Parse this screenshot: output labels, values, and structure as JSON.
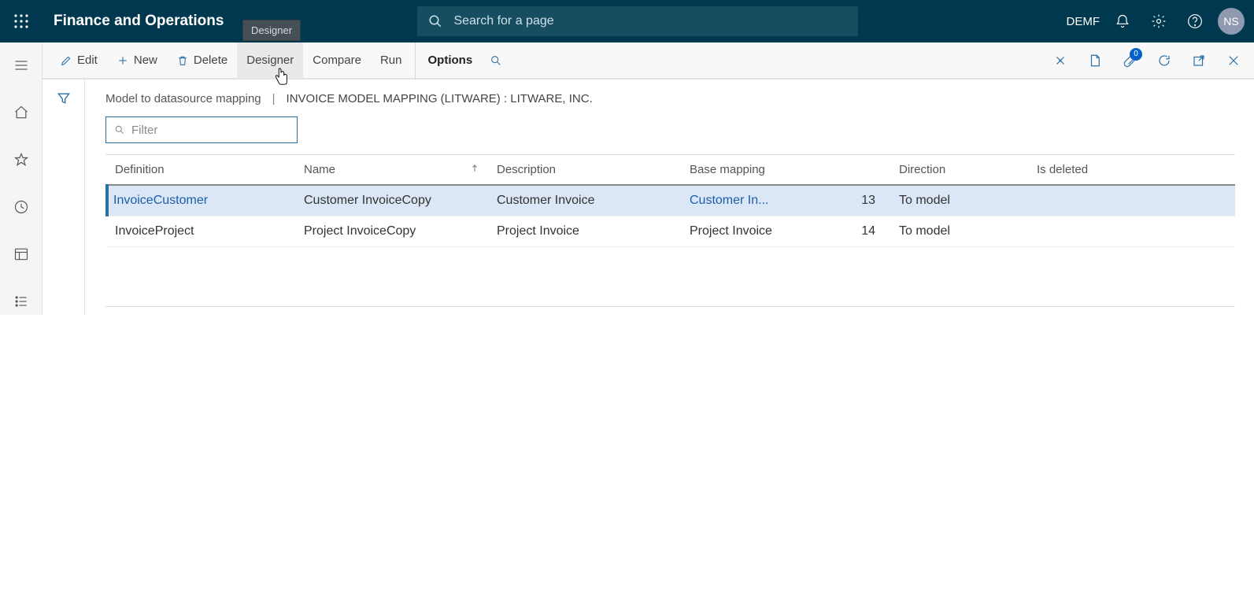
{
  "header": {
    "app_title": "Finance and Operations",
    "search_placeholder": "Search for a page",
    "company": "DEMF",
    "avatar_initials": "NS",
    "tooltip_designer": "Designer",
    "attachments_badge": "0"
  },
  "actions": {
    "edit": "Edit",
    "new": "New",
    "delete": "Delete",
    "designer": "Designer",
    "compare": "Compare",
    "run": "Run",
    "options": "Options"
  },
  "breadcrumb": {
    "page": "Model to datasource mapping",
    "title": "INVOICE MODEL MAPPING (LITWARE) : LITWARE, INC."
  },
  "filter": {
    "placeholder": "Filter"
  },
  "columns": {
    "definition": "Definition",
    "name": "Name",
    "description": "Description",
    "base_mapping": "Base mapping",
    "direction": "Direction",
    "is_deleted": "Is deleted"
  },
  "rows": [
    {
      "definition": "InvoiceCustomer",
      "name": "Customer InvoiceCopy",
      "description": "Customer Invoice",
      "base_mapping": "Customer In...",
      "seq": "13",
      "direction": "To model",
      "is_deleted": "",
      "selected": true,
      "definition_link": true,
      "base_link": true
    },
    {
      "definition": "InvoiceProject",
      "name": "Project InvoiceCopy",
      "description": "Project Invoice",
      "base_mapping": "Project Invoice",
      "seq": "14",
      "direction": "To model",
      "is_deleted": "",
      "selected": false,
      "definition_link": false,
      "base_link": false
    }
  ]
}
